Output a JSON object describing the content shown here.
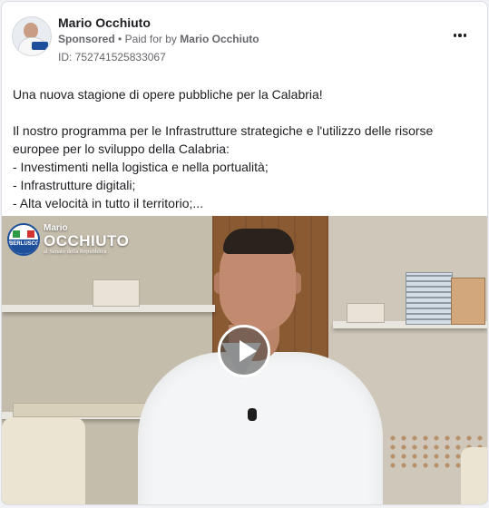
{
  "post": {
    "author_name": "Mario Occhiuto",
    "sponsored_label": "Sponsored",
    "separator": "•",
    "paid_for_prefix": "Paid for by",
    "paid_for_name": "Mario Occhiuto",
    "id_line": "ID: 752741525833067",
    "text_lines": [
      "Una nuova stagione di opere pubbliche per la Calabria!",
      "",
      "Il nostro programma per le Infrastrutture strategiche e l'utilizzo delle risorse",
      "europee per lo sviluppo della Calabria:",
      "- Investimenti nella logistica e nella portualità;",
      "- Infrastrutture digitali;",
      "- Alta velocità in tutto il territorio;..."
    ]
  },
  "video": {
    "logo_badge_text": "BERLUSCONI",
    "logo_first_name": "Mario",
    "logo_last_name": "OCCHIUTO",
    "logo_subtitle": "al Senato della Repubblica",
    "play_icon": "play-icon"
  },
  "icons": {
    "more": "more-options-icon",
    "avatar": "profile-avatar"
  },
  "colors": {
    "text_primary": "#1c1e21",
    "text_secondary": "#65676b",
    "card_bg": "#ffffff",
    "page_bg": "#f0f2f5",
    "party_blue": "#1d4f9a"
  }
}
